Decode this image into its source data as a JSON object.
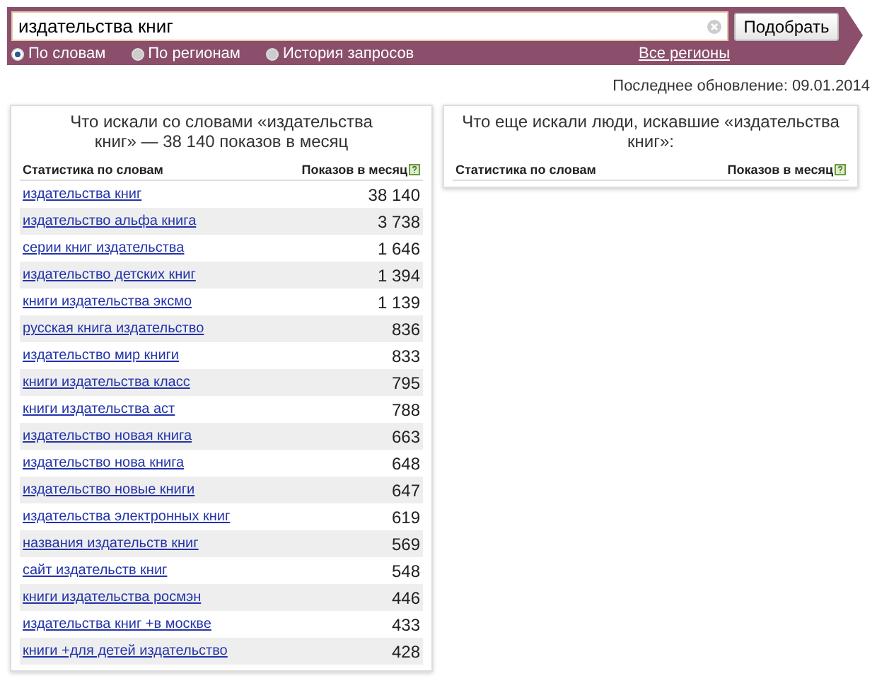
{
  "search": {
    "value": "издательства книг",
    "button": "Подобрать",
    "modes": [
      {
        "label": "По словам",
        "selected": true
      },
      {
        "label": "По регионам",
        "selected": false
      },
      {
        "label": "История запросов",
        "selected": false
      }
    ],
    "regions_link": "Все регионы"
  },
  "last_update": "Последнее обновление: 09.01.2014",
  "panels": [
    {
      "title": "Что искали со словами «издательства книг» — 38 140 показов в месяц",
      "columns": [
        "Статистика по словам",
        "Показов в месяц"
      ],
      "rows": [
        {
          "phrase": "издательства книг",
          "count": "38 140"
        },
        {
          "phrase": "издательство альфа книга",
          "count": "3 738"
        },
        {
          "phrase": "серии книг издательства",
          "count": "1 646"
        },
        {
          "phrase": "издательство детских книг",
          "count": "1 394"
        },
        {
          "phrase": "книги издательства эксмо",
          "count": "1 139"
        },
        {
          "phrase": "русская книга издательство",
          "count": "836"
        },
        {
          "phrase": "издательство мир книги",
          "count": "833"
        },
        {
          "phrase": "книги издательства класс",
          "count": "795"
        },
        {
          "phrase": "книги издательства аст",
          "count": "788"
        },
        {
          "phrase": "издательство новая книга",
          "count": "663"
        },
        {
          "phrase": "издательство нова книга",
          "count": "648"
        },
        {
          "phrase": "издательство новые книги",
          "count": "647"
        },
        {
          "phrase": "издательства электронных книг",
          "count": "619"
        },
        {
          "phrase": "названия издательств книг",
          "count": "569"
        },
        {
          "phrase": "сайт издательств книг",
          "count": "548"
        },
        {
          "phrase": "книги издательства росмэн",
          "count": "446"
        },
        {
          "phrase": "издательства книг +в москве",
          "count": "433"
        },
        {
          "phrase": "книги +для детей издательство",
          "count": "428"
        }
      ]
    },
    {
      "title": "Что еще искали люди, искавшие «издательства книг»:",
      "columns": [
        "Статистика по словам",
        "Показов в месяц"
      ]
    }
  ]
}
